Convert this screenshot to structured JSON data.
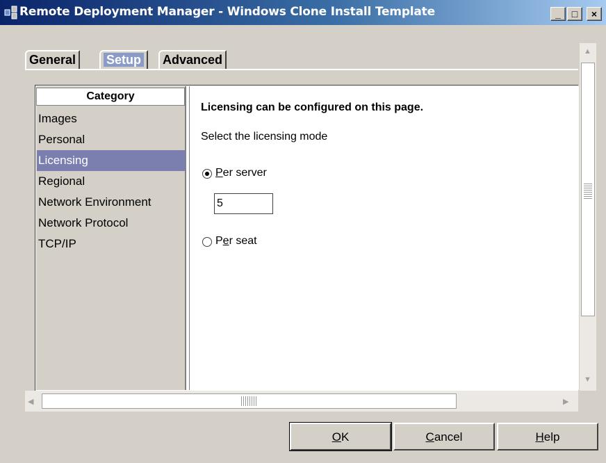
{
  "window": {
    "title": "Remote Deployment Manager - Windows Clone Install Template",
    "controls": {
      "minimize": "_",
      "maximize": "□",
      "close": "×"
    }
  },
  "tabs": [
    {
      "label": "General",
      "active": false
    },
    {
      "label": "Setup",
      "active": true
    },
    {
      "label": "Advanced",
      "active": false
    }
  ],
  "category": {
    "header": "Category",
    "items": [
      "Images",
      "Personal",
      "Licensing",
      "Regional",
      "Network Environment",
      "Network Protocol",
      "TCP/IP"
    ],
    "selected": "Licensing"
  },
  "content": {
    "heading": "Licensing can be configured on this page.",
    "prompt": "Select the licensing mode",
    "options": [
      {
        "first": "P",
        "rest": "er server",
        "checked": true
      },
      {
        "pre": "P",
        "mnemonic": "e",
        "rest": "r seat",
        "checked": false
      }
    ],
    "server_count": "5"
  },
  "buttons": {
    "ok": {
      "mnemonic": "O",
      "rest": "K"
    },
    "cancel": {
      "mnemonic": "C",
      "rest": "ancel"
    },
    "help": {
      "mnemonic": "H",
      "rest": "elp"
    }
  },
  "colors": {
    "selection": "#7b7fb0",
    "active_tab": "#8b9bc8",
    "titlebar_start": "#0a246a"
  }
}
